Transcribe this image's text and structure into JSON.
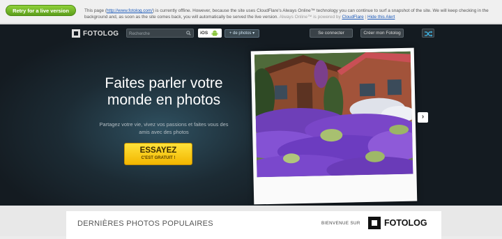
{
  "always_online": {
    "retry_button": "Retry for a live version",
    "message_start": "This page (",
    "page_url": "http://www.fotolog.com/",
    "message_middle": ") is currently offline. However, because the site uses CloudFlare's Always Online™ technology you can continue to surf a snapshot of the site. We will keep checking in the background and, as soon as the site comes back, you will automatically be served the live version.",
    "powered_prefix": "Always Online™ is powered by",
    "cloudflare_link": "CloudFlare",
    "separator": "|",
    "hide_alert": "Hide this Alert"
  },
  "header": {
    "logo": "FOTOLOG",
    "search_placeholder": "Recherche",
    "ios_label": "iOS",
    "more_photos": "+ de photos ▾",
    "login": "Se connecter",
    "signup": "Créer mon Fotolog"
  },
  "hero": {
    "headline": "Faites parler votre monde en photos",
    "subline": "Partagez votre vie, vivez vos passions et faites vous des amis avec des photos",
    "cta_main": "ESSAYEZ",
    "cta_sub": "C'EST GRATUIT !",
    "next_arrow": "›"
  },
  "popular": {
    "title": "DERNIÈRES PHOTOS POPULAIRES",
    "welcome": "BIENVENUE SUR",
    "logo": "FOTOLOG"
  },
  "colors": {
    "retry_green": "#6cb52a",
    "cta_yellow": "#f7c800",
    "hero_bg": "#1c2b34"
  }
}
